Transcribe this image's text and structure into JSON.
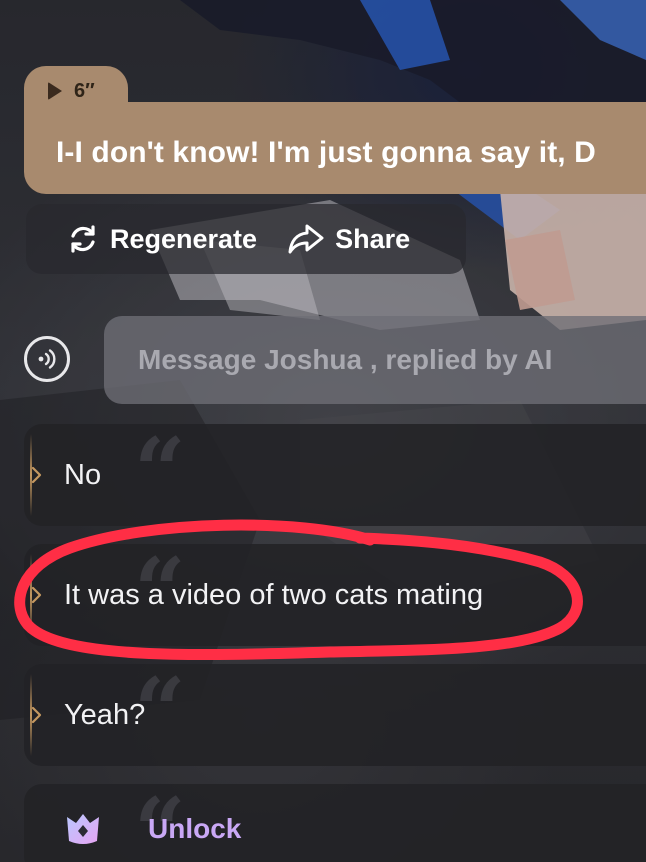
{
  "voice_message": {
    "duration": "6″",
    "text": "I-I don't know! I'm just gonna say it, D"
  },
  "actions": {
    "regenerate_label": "Regenerate",
    "share_label": "Share"
  },
  "composer": {
    "placeholder": "Message Joshua , replied by AI"
  },
  "suggestions": [
    {
      "text": "No"
    },
    {
      "text": "It was a video of two cats mating"
    },
    {
      "text": "Yeah?"
    }
  ],
  "unlock": {
    "label": "Unlock"
  },
  "colors": {
    "voice_bubble": "#a88a6e",
    "card_accent": "#c49860",
    "unlock_text": "#c9a8f5",
    "annotation_red": "#ff2e45"
  }
}
